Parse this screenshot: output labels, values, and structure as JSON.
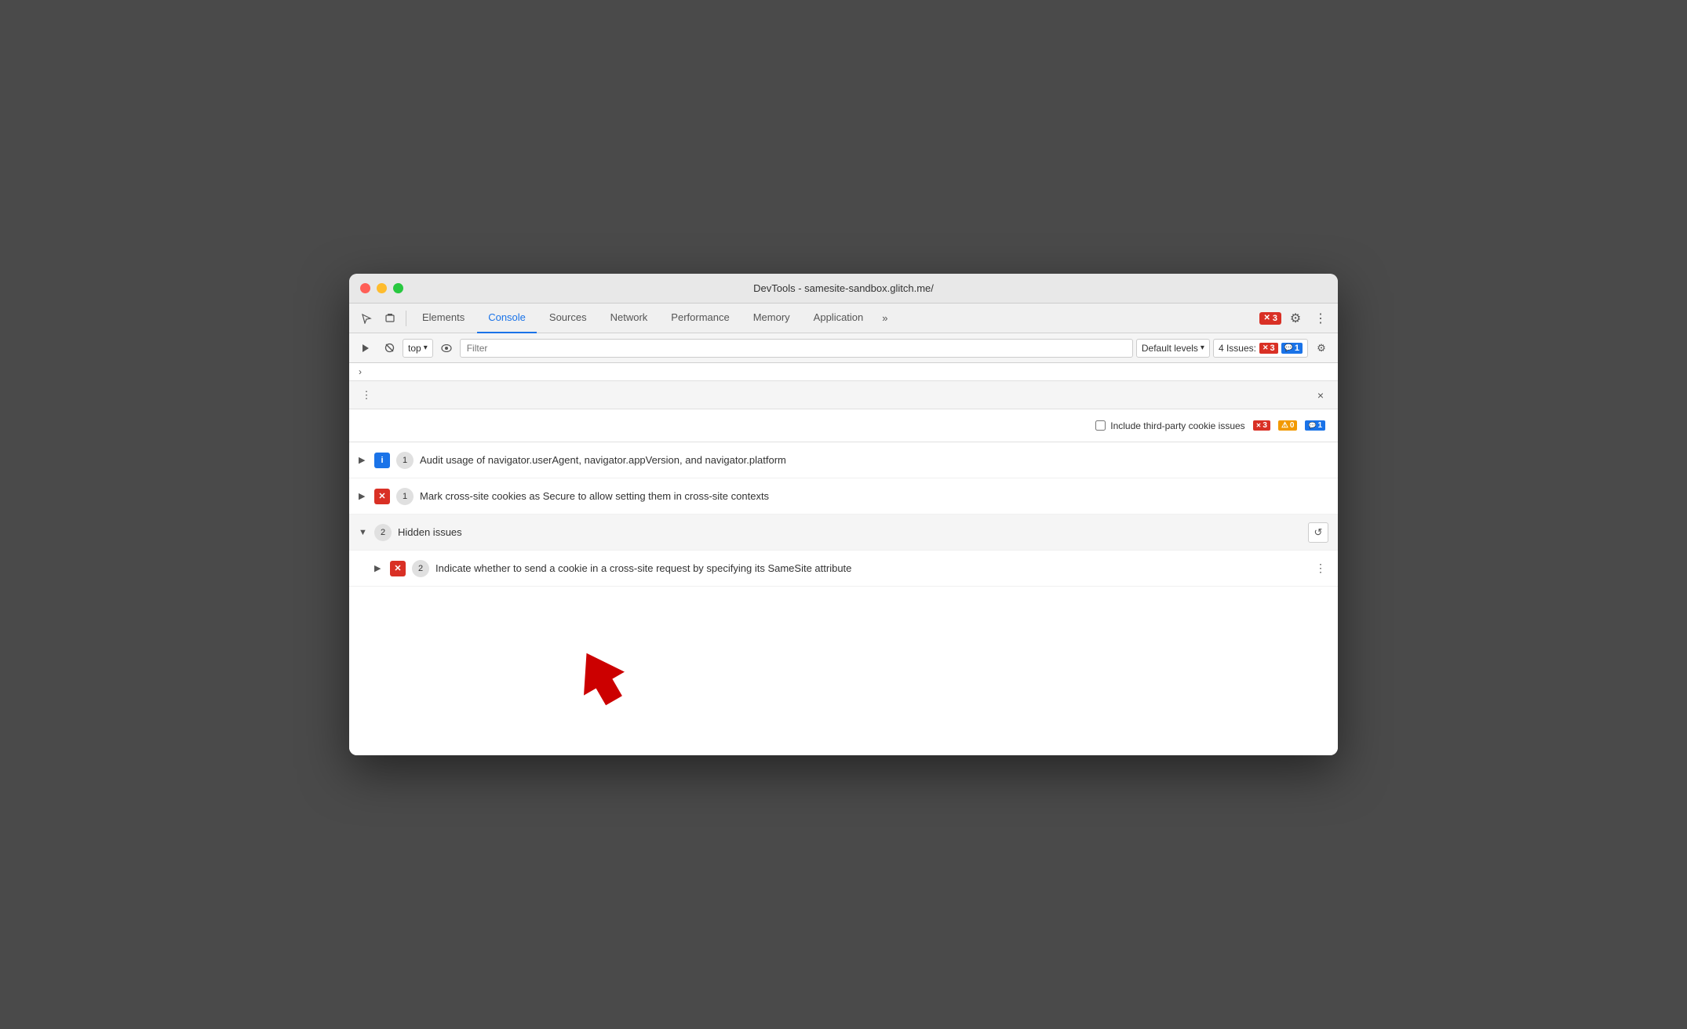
{
  "window": {
    "title": "DevTools - samesite-sandbox.glitch.me/"
  },
  "traffic_lights": {
    "close": "close",
    "minimize": "minimize",
    "maximize": "maximize"
  },
  "tabs": [
    {
      "id": "elements",
      "label": "Elements",
      "active": false
    },
    {
      "id": "console",
      "label": "Console",
      "active": true
    },
    {
      "id": "sources",
      "label": "Sources",
      "active": false
    },
    {
      "id": "network",
      "label": "Network",
      "active": false
    },
    {
      "id": "performance",
      "label": "Performance",
      "active": false
    },
    {
      "id": "memory",
      "label": "Memory",
      "active": false
    },
    {
      "id": "application",
      "label": "Application",
      "active": false
    }
  ],
  "tab_more_label": "»",
  "error_count": "3",
  "toolbar": {
    "context_selector": "top",
    "filter_placeholder": "Filter",
    "default_levels_label": "Default levels",
    "issues_label": "4 Issues:",
    "issues_error_count": "3",
    "issues_info_count": "1"
  },
  "issues_panel": {
    "close_icon": "×",
    "include_cookie_label": "Include third-party cookie issues",
    "badge_red_count": "3",
    "badge_orange_count": "0",
    "badge_blue_count": "1"
  },
  "issue_rows": [
    {
      "id": "audit-row",
      "expanded": false,
      "icon_type": "blue",
      "icon_label": "i",
      "count": "1",
      "text": "Audit usage of navigator.userAgent, navigator.appVersion, and navigator.platform"
    },
    {
      "id": "mark-cookie-row",
      "expanded": false,
      "icon_type": "red",
      "icon_label": "✕",
      "count": "1",
      "text": "Mark cross-site cookies as Secure to allow setting them in cross-site contexts"
    }
  ],
  "hidden_group": {
    "expanded": true,
    "count": "2",
    "label": "Hidden issues",
    "sub_rows": [
      {
        "id": "samesite-row",
        "expanded": false,
        "icon_type": "red",
        "icon_label": "✕",
        "count": "2",
        "text": "Indicate whether to send a cookie in a cross-site request by specifying its SameSite attribute"
      }
    ]
  },
  "icons": {
    "cursor": "↖",
    "layers": "⧉",
    "play": "▶",
    "block": "⊘",
    "eye": "👁",
    "chevron_down": "▾",
    "gear": "⚙",
    "more_vert": "⋮",
    "refresh": "↺",
    "close": "×",
    "expand_right": "▶",
    "expand_down": "▼",
    "nav_chevron": "›"
  }
}
